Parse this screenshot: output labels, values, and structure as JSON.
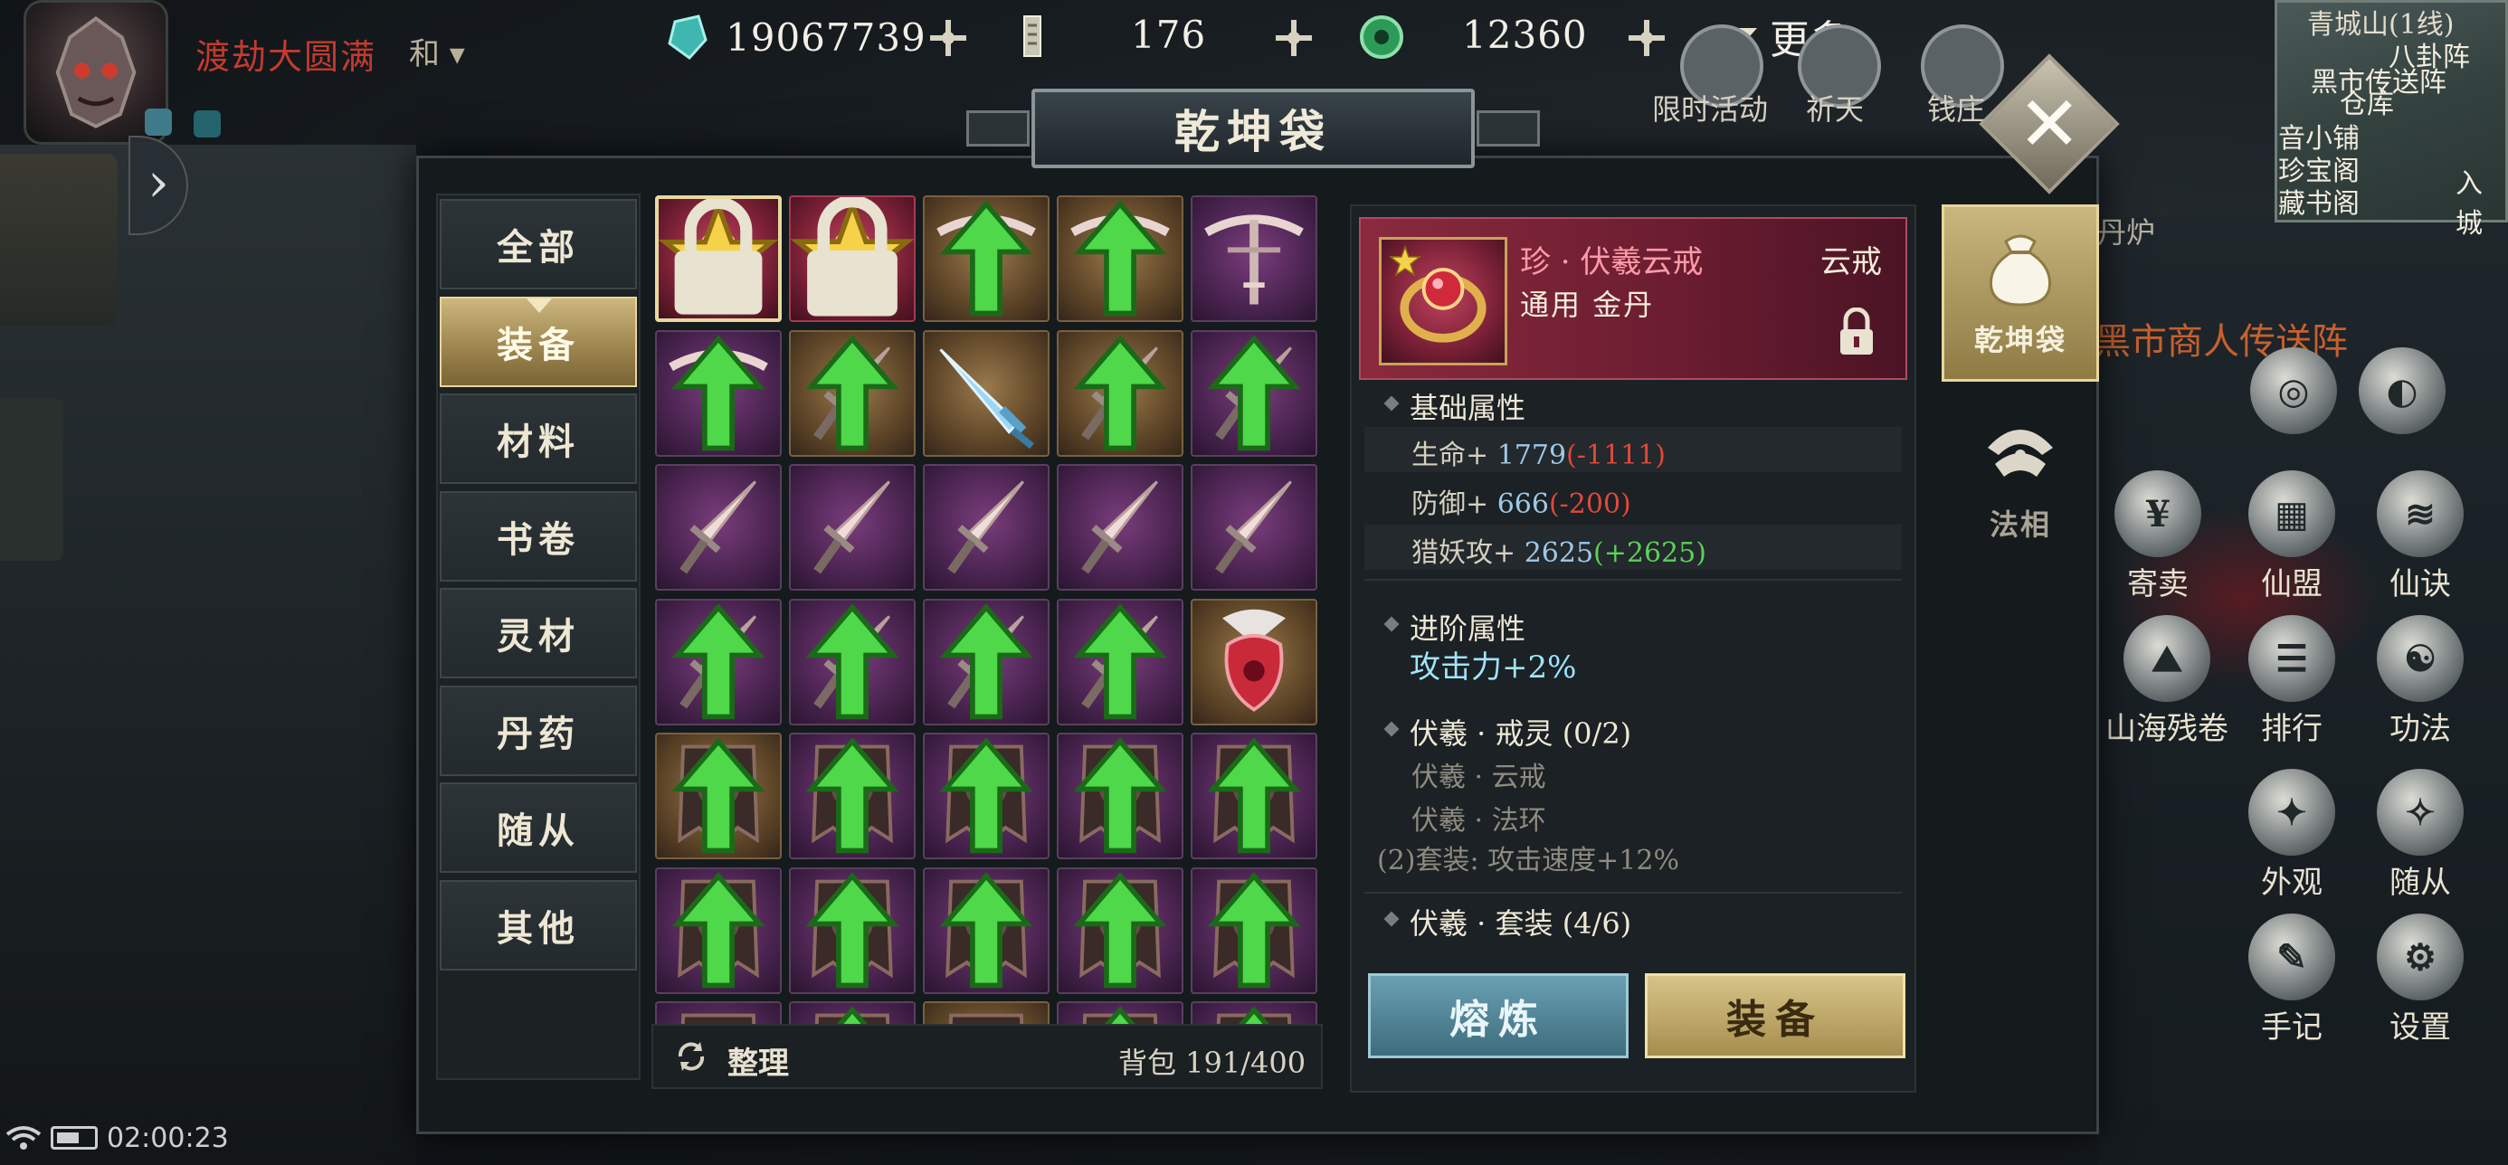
{
  "player": {
    "status": "渡劫大圆满",
    "tag": "和"
  },
  "currencies": [
    {
      "icon": "jade-crystal-icon",
      "value": "19067739"
    },
    {
      "icon": "talisman-icon",
      "value": "176"
    },
    {
      "icon": "jade-coin-icon",
      "value": "12360"
    }
  ],
  "more_label": "更多",
  "top_icons": [
    {
      "icon": "limited-event-icon",
      "label": "限时活动"
    },
    {
      "icon": "pray-icon",
      "label": "祈天"
    },
    {
      "icon": "money-bag-icon",
      "label": "钱庄"
    }
  ],
  "minimap": {
    "location": "青城山(1线)",
    "labels": [
      "八卦阵",
      "黑市传送阵",
      "仓库",
      "音小铺",
      "珍宝阁",
      "藏书阁",
      "入城"
    ]
  },
  "right_menu": {
    "furnace": "丹炉",
    "portal": "黑市商人传送阵",
    "items": [
      {
        "icon": "trade-icon",
        "label": "寄卖"
      },
      {
        "icon": "alliance-icon",
        "label": "仙盟"
      },
      {
        "icon": "scroll-icon",
        "label": "仙诀"
      },
      {
        "icon": "mountain-scroll-icon",
        "label": "山海残卷"
      },
      {
        "icon": "ranking-icon",
        "label": "排行"
      },
      {
        "icon": "taiji-icon",
        "label": "功法"
      },
      {
        "icon": "appearance-icon",
        "label": "外观"
      },
      {
        "icon": "follower-icon",
        "label": "随从"
      },
      {
        "icon": "notebook-icon",
        "label": "手记"
      },
      {
        "icon": "settings-icon",
        "label": "设置"
      }
    ]
  },
  "status_bar": {
    "time": "02:00:23"
  },
  "panel": {
    "title": "乾坤袋",
    "close_label": "✕",
    "categories": [
      {
        "label": "全部",
        "active": false
      },
      {
        "label": "装备",
        "active": true
      },
      {
        "label": "材料",
        "active": false
      },
      {
        "label": "书卷",
        "active": false
      },
      {
        "label": "灵材",
        "active": false
      },
      {
        "label": "丹药",
        "active": false
      },
      {
        "label": "随从",
        "active": false
      },
      {
        "label": "其他",
        "active": false
      }
    ],
    "sort_label": "整理",
    "bag_label": "背包 191/400",
    "tabs": [
      {
        "label": "乾坤袋",
        "active": true
      },
      {
        "label": "法相",
        "active": false
      }
    ]
  },
  "items": [
    {
      "kind": "ring",
      "rarity": "red",
      "star": true,
      "locked": true,
      "upgrade": false,
      "selected": true
    },
    {
      "kind": "ring",
      "rarity": "red",
      "star": true,
      "locked": true,
      "upgrade": false,
      "selected": false
    },
    {
      "kind": "crossbow",
      "rarity": "gold",
      "star": false,
      "locked": false,
      "upgrade": true,
      "selected": false
    },
    {
      "kind": "crossbow",
      "rarity": "gold",
      "star": false,
      "locked": false,
      "upgrade": true,
      "selected": false
    },
    {
      "kind": "crossbow",
      "rarity": "purple",
      "star": false,
      "locked": false,
      "upgrade": false,
      "selected": false
    },
    {
      "kind": "crossbow",
      "rarity": "purple",
      "star": false,
      "locked": false,
      "upgrade": true,
      "selected": false
    },
    {
      "kind": "dagger",
      "rarity": "gold",
      "star": false,
      "locked": false,
      "upgrade": true,
      "selected": false
    },
    {
      "kind": "ice-sword",
      "rarity": "gold",
      "star": false,
      "locked": false,
      "upgrade": false,
      "selected": false
    },
    {
      "kind": "dagger",
      "rarity": "gold",
      "star": false,
      "locked": false,
      "upgrade": true,
      "selected": false
    },
    {
      "kind": "dagger",
      "rarity": "purple",
      "star": false,
      "locked": false,
      "upgrade": true,
      "selected": false
    },
    {
      "kind": "dagger",
      "rarity": "purple",
      "star": false,
      "locked": false,
      "upgrade": false,
      "selected": false
    },
    {
      "kind": "dagger",
      "rarity": "purple",
      "star": false,
      "locked": false,
      "upgrade": false,
      "selected": false
    },
    {
      "kind": "dagger",
      "rarity": "purple",
      "star": false,
      "locked": false,
      "upgrade": false,
      "selected": false
    },
    {
      "kind": "dagger",
      "rarity": "purple",
      "star": false,
      "locked": false,
      "upgrade": false,
      "selected": false
    },
    {
      "kind": "dagger",
      "rarity": "purple",
      "star": false,
      "locked": false,
      "upgrade": false,
      "selected": false
    },
    {
      "kind": "dagger",
      "rarity": "purple",
      "star": false,
      "locked": false,
      "upgrade": true,
      "selected": false
    },
    {
      "kind": "dagger",
      "rarity": "purple",
      "star": false,
      "locked": false,
      "upgrade": true,
      "selected": false
    },
    {
      "kind": "dagger",
      "rarity": "purple",
      "star": false,
      "locked": false,
      "upgrade": true,
      "selected": false
    },
    {
      "kind": "dagger",
      "rarity": "purple",
      "star": false,
      "locked": false,
      "upgrade": true,
      "selected": false
    },
    {
      "kind": "pendant",
      "rarity": "gold",
      "star": false,
      "locked": false,
      "upgrade": false,
      "selected": false
    },
    {
      "kind": "banner",
      "rarity": "gold",
      "star": false,
      "locked": false,
      "upgrade": true,
      "selected": false
    },
    {
      "kind": "banner",
      "rarity": "purple",
      "star": false,
      "locked": false,
      "upgrade": true,
      "selected": false
    },
    {
      "kind": "banner",
      "rarity": "purple",
      "star": false,
      "locked": false,
      "upgrade": true,
      "selected": false
    },
    {
      "kind": "banner",
      "rarity": "purple",
      "star": false,
      "locked": false,
      "upgrade": true,
      "selected": false
    },
    {
      "kind": "banner",
      "rarity": "purple",
      "star": false,
      "locked": false,
      "upgrade": true,
      "selected": false
    },
    {
      "kind": "banner",
      "rarity": "purple",
      "star": false,
      "locked": false,
      "upgrade": true,
      "selected": false
    },
    {
      "kind": "banner",
      "rarity": "purple",
      "star": false,
      "locked": false,
      "upgrade": true,
      "selected": false
    },
    {
      "kind": "banner",
      "rarity": "purple",
      "star": false,
      "locked": false,
      "upgrade": true,
      "selected": false
    },
    {
      "kind": "banner",
      "rarity": "purple",
      "star": false,
      "locked": false,
      "upgrade": true,
      "selected": false
    },
    {
      "kind": "banner",
      "rarity": "purple",
      "star": false,
      "locked": false,
      "upgrade": true,
      "selected": false
    },
    {
      "kind": "banner",
      "rarity": "purple",
      "star": false,
      "locked": false,
      "upgrade": false,
      "selected": false
    },
    {
      "kind": "banner",
      "rarity": "purple",
      "star": false,
      "locked": false,
      "upgrade": true,
      "selected": false
    },
    {
      "kind": "banner",
      "rarity": "gold",
      "star": false,
      "locked": false,
      "upgrade": false,
      "selected": false
    },
    {
      "kind": "banner",
      "rarity": "purple",
      "star": false,
      "locked": false,
      "upgrade": true,
      "selected": false
    },
    {
      "kind": "banner",
      "rarity": "purple",
      "star": false,
      "locked": false,
      "upgrade": true,
      "selected": false
    }
  ],
  "detail": {
    "name": "珍 · 伏羲云戒",
    "type": "云戒",
    "sub": "通用 金丹",
    "base_title": "基础属性",
    "stats": [
      {
        "label": "生命+",
        "value": "1779",
        "diff": "(-1111)",
        "diff_type": "neg"
      },
      {
        "label": "防御+",
        "value": "666",
        "diff": "(-200)",
        "diff_type": "neg"
      },
      {
        "label": "猎妖攻+",
        "value": "2625",
        "diff": "(+2625)",
        "diff_type": "pos"
      }
    ],
    "adv_title": "进阶属性",
    "adv_value": "攻击力+2%",
    "set1_title": "伏羲 · 戒灵 (0/2)",
    "set1_items": [
      "伏羲 · 云戒",
      "伏羲 · 法环",
      "(2)套装: 攻击速度+12%"
    ],
    "set2_title": "伏羲 · 套装 (4/6)",
    "btn_smelt": "熔炼",
    "btn_equip": "装备"
  }
}
